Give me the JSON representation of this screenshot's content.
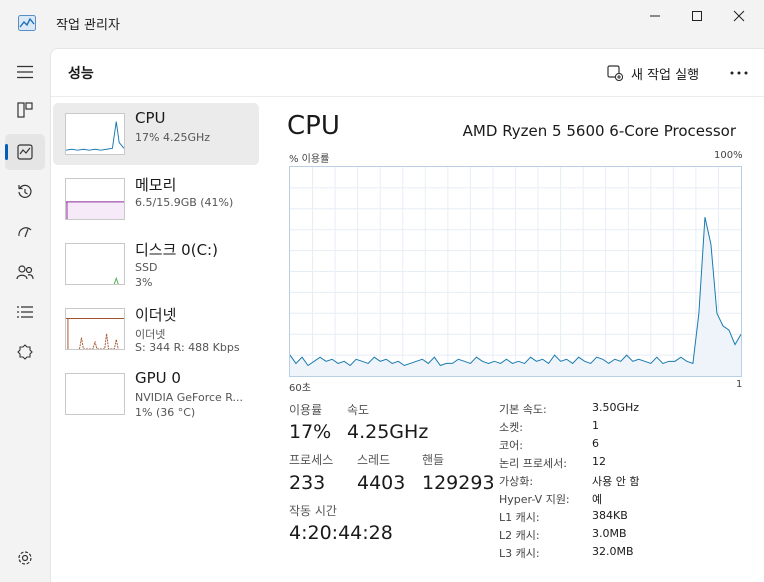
{
  "window": {
    "title": "작업 관리자"
  },
  "page": {
    "title": "성능",
    "new_task": "새 작업 실행"
  },
  "devices": [
    {
      "name": "CPU",
      "sub1": "17% 4.25GHz"
    },
    {
      "name": "메모리",
      "sub1": "6.5/15.9GB (41%)"
    },
    {
      "name": "디스크 0(C:)",
      "sub1": "SSD",
      "sub2": "3%"
    },
    {
      "name": "이더넷",
      "sub1": "이더넷",
      "sub2": "S: 344 R: 488 Kbps"
    },
    {
      "name": "GPU 0",
      "sub1": "NVIDIA GeForce R...",
      "sub2": "1% (36 °C)"
    }
  ],
  "detail": {
    "title": "CPU",
    "model": "AMD Ryzen 5 5600 6-Core Processor",
    "graph_label": "% 이용률",
    "graph_max": "100%",
    "graph_time": "60초",
    "graph_end": "1",
    "utilization_series": [
      10,
      6,
      9,
      5,
      7,
      9,
      7,
      8,
      6,
      7,
      5,
      8,
      7,
      6,
      9,
      7,
      8,
      6,
      7,
      5,
      6,
      7,
      8,
      6,
      9,
      5,
      6,
      6,
      8,
      7,
      6,
      9,
      7,
      6,
      7,
      6,
      8,
      6,
      7,
      6,
      9,
      7,
      8,
      6,
      10,
      7,
      8,
      6,
      9,
      7,
      6,
      9,
      8,
      6,
      8,
      7,
      10,
      7,
      8,
      7,
      6,
      9,
      6,
      7,
      7,
      9,
      7,
      6,
      30,
      76,
      63,
      30,
      24,
      22,
      15,
      20
    ]
  },
  "stats": {
    "util_label": "이용률",
    "util_value": "17%",
    "speed_label": "속도",
    "speed_value": "4.25GHz",
    "proc_label": "프로세스",
    "proc_value": "233",
    "thread_label": "스레드",
    "thread_value": "4403",
    "handle_label": "핸들",
    "handle_value": "129293",
    "uptime_label": "작동 시간",
    "uptime_value": "4:20:44:28"
  },
  "specs": [
    {
      "k": "기본 속도:",
      "v": "3.50GHz"
    },
    {
      "k": "소켓:",
      "v": "1"
    },
    {
      "k": "코어:",
      "v": "6"
    },
    {
      "k": "논리 프로세서:",
      "v": "12"
    },
    {
      "k": "가상화:",
      "v": "사용 안 함"
    },
    {
      "k": "Hyper-V 지원:",
      "v": "예"
    },
    {
      "k": "L1 캐시:",
      "v": "384KB"
    },
    {
      "k": "L2 캐시:",
      "v": "3.0MB"
    },
    {
      "k": "L3 캐시:",
      "v": "32.0MB"
    }
  ],
  "colors": {
    "accent": "#005fb8",
    "cpu": "#1a7ab0",
    "memory": "#8b2b9a",
    "disk": "#4caf50",
    "ethernet": "#a0522d"
  },
  "icons": [
    "app-icon",
    "minimize-icon",
    "maximize-icon",
    "close-icon",
    "hamburger-icon",
    "processes-icon",
    "performance-icon",
    "app-history-icon",
    "startup-icon",
    "users-icon",
    "details-icon",
    "services-icon",
    "settings-icon",
    "new-task-icon",
    "more-icon"
  ]
}
